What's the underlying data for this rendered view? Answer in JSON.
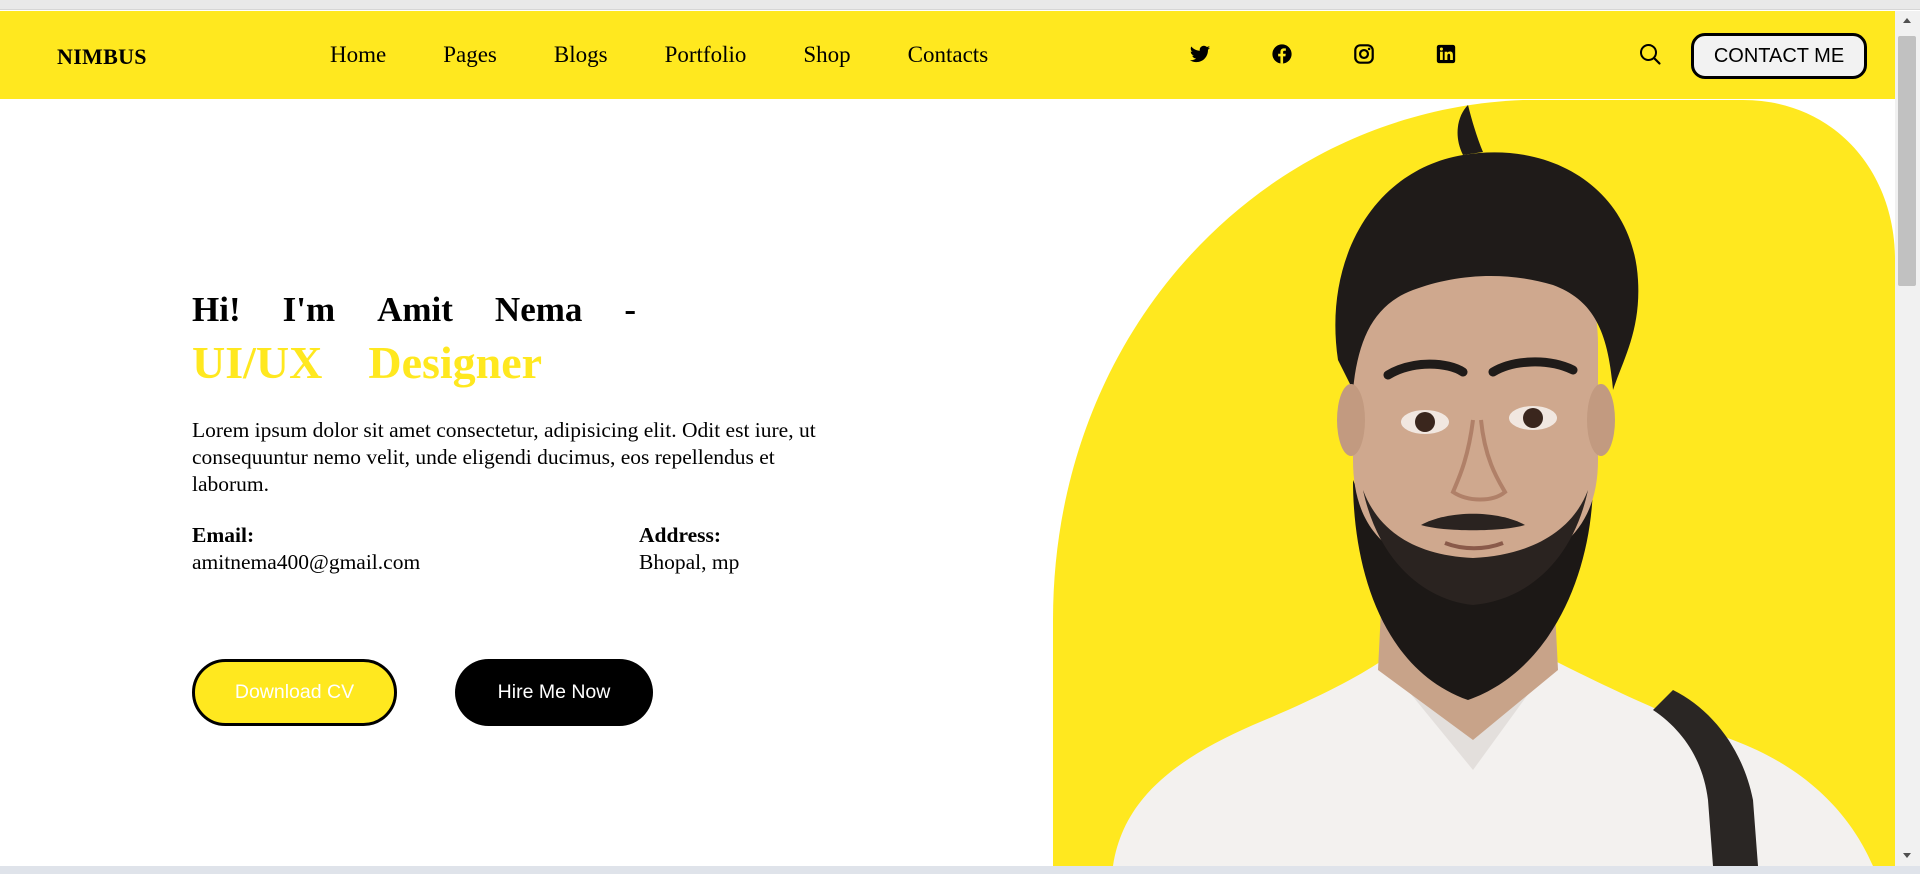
{
  "navbar": {
    "brand": "NIMBUS",
    "links": [
      "Home",
      "Pages",
      "Blogs",
      "Portfolio",
      "Shop",
      "Contacts"
    ],
    "social_icons": [
      "twitter-icon",
      "facebook-icon",
      "instagram-icon",
      "linkedin-icon"
    ],
    "search_icon": "search-icon",
    "contact_button": "CONTACT ME"
  },
  "hero": {
    "greeting_words": [
      "Hi!",
      "I'm",
      "Amit",
      "Nema",
      "-"
    ],
    "role_words": [
      "UI/UX",
      "Designer"
    ],
    "description": "Lorem ipsum dolor sit amet consectetur, adipisicing elit. Odit est iure, ut consequuntur nemo velit, unde eligendi ducimus, eos repellendus et laborum.",
    "email_label": "Email:",
    "email_value": "amitnema400@gmail.com",
    "address_label": "Address:",
    "address_value": "Bhopal, mp",
    "download_button": "Download CV",
    "hire_button": "Hire Me Now"
  },
  "colors": {
    "accent": "#ffe81f",
    "dark": "#000000",
    "background": "#ffffff"
  }
}
